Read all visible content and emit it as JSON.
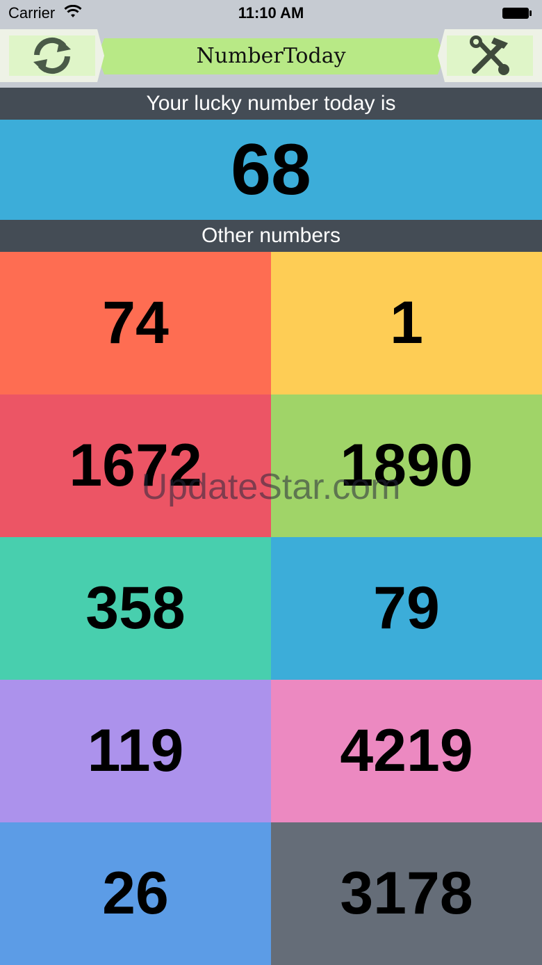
{
  "status_bar": {
    "carrier": "Carrier",
    "time": "11:10 AM"
  },
  "nav": {
    "title": "NumberToday",
    "left_icon": "refresh-icon",
    "right_icon": "tools-icon"
  },
  "lucky": {
    "header": "Your lucky number today is",
    "number": "68",
    "color": "#3cadd9"
  },
  "others": {
    "header": "Other numbers",
    "cells": [
      {
        "value": "74",
        "color": "#fe6d52"
      },
      {
        "value": "1",
        "color": "#fecd55"
      },
      {
        "value": "1672",
        "color": "#ec5565"
      },
      {
        "value": "1890",
        "color": "#a0d468"
      },
      {
        "value": "358",
        "color": "#48cfae"
      },
      {
        "value": "79",
        "color": "#3cadd9"
      },
      {
        "value": "119",
        "color": "#ac92ec"
      },
      {
        "value": "4219",
        "color": "#ec89c1"
      },
      {
        "value": "26",
        "color": "#5c9ce6"
      },
      {
        "value": "3178",
        "color": "#656d78"
      }
    ]
  },
  "watermark": "UpdateStar.com"
}
